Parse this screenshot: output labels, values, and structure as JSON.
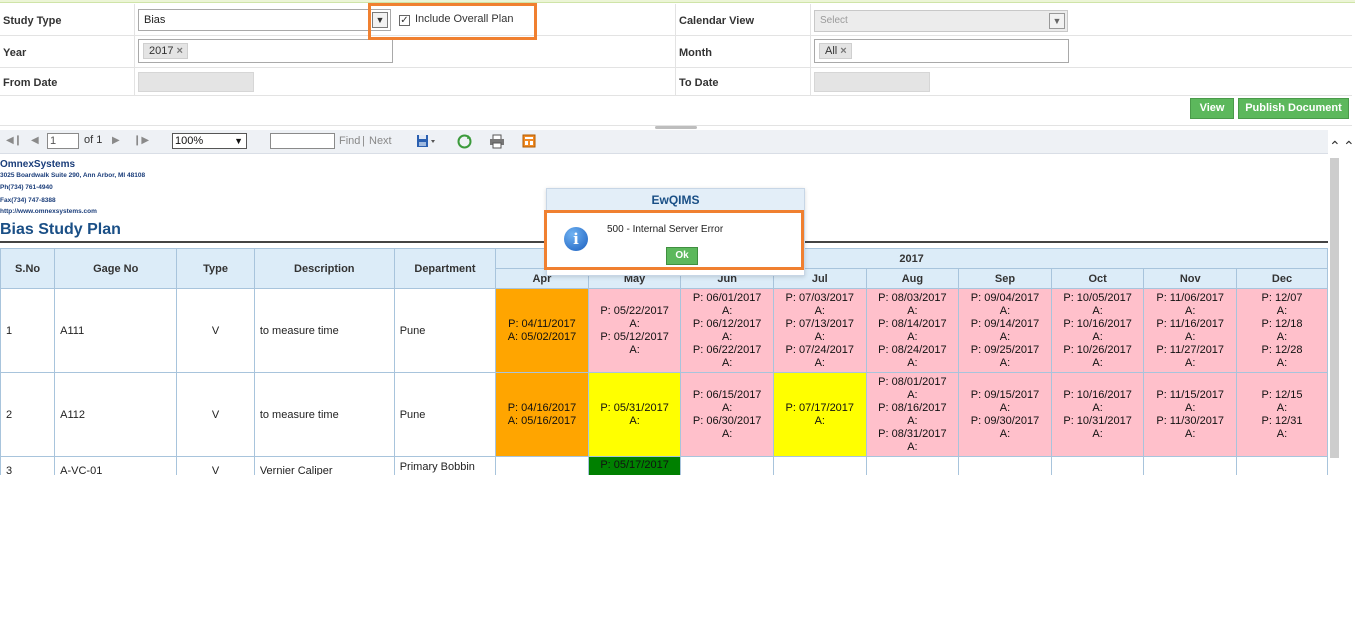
{
  "filters": {
    "study_type_label": "Study Type",
    "study_type_value": "Bias",
    "include_overall_label": "Include Overall Plan",
    "include_overall_checked": true,
    "calendar_view_label": "Calendar View",
    "calendar_view_placeholder": "Select",
    "year_label": "Year",
    "year_tag": "2017",
    "month_label": "Month",
    "month_tag": "All",
    "from_date_label": "From Date",
    "to_date_label": "To Date",
    "view_button": "View",
    "publish_button": "Publish Document"
  },
  "toolbar": {
    "page_value": "1",
    "page_of": "of 1",
    "zoom": "100%",
    "find": "Find",
    "separator": "|",
    "next": "Next",
    "icons": [
      "first-page-icon",
      "prev-page-icon",
      "next-page-icon",
      "last-page-icon",
      "export-icon",
      "refresh-icon",
      "print-icon",
      "document-map-icon"
    ]
  },
  "report": {
    "company": "OmnexSystems",
    "address": "3025 Boardwalk Suite 290, Ann Arbor, MI 48108",
    "phone": "Ph(734) 761-4940",
    "fax": "Fax(734) 747-8388",
    "web": "http://www.omnexsystems.com",
    "title": "Bias Study Plan",
    "headers": {
      "sno": "S.No",
      "gage": "Gage No",
      "type": "Type",
      "description": "Description",
      "department": "Department",
      "year": "2017"
    },
    "months": [
      "Apr",
      "May",
      "Jun",
      "Jul",
      "Aug",
      "Sep",
      "Oct",
      "Nov",
      "Dec"
    ],
    "rows": [
      {
        "sno": "1",
        "gage": "A111",
        "type": "V",
        "description": "to measure time",
        "department": "Pune",
        "cells": [
          {
            "color": "orange",
            "lines": [
              "P: 04/11/2017",
              "A: 05/02/2017"
            ]
          },
          {
            "color": "pink",
            "lines": [
              "P: 05/22/2017",
              "A:",
              "P: 05/12/2017",
              "A:"
            ]
          },
          {
            "color": "pink",
            "lines": [
              "P: 06/01/2017",
              "A:",
              "P: 06/12/2017",
              "A:",
              "P: 06/22/2017",
              "A:"
            ]
          },
          {
            "color": "pink",
            "lines": [
              "P: 07/03/2017",
              "A:",
              "P: 07/13/2017",
              "A:",
              "P: 07/24/2017",
              "A:"
            ]
          },
          {
            "color": "pink",
            "lines": [
              "P: 08/03/2017",
              "A:",
              "P: 08/14/2017",
              "A:",
              "P: 08/24/2017",
              "A:"
            ]
          },
          {
            "color": "pink",
            "lines": [
              "P: 09/04/2017",
              "A:",
              "P: 09/14/2017",
              "A:",
              "P: 09/25/2017",
              "A:"
            ]
          },
          {
            "color": "pink",
            "lines": [
              "P: 10/05/2017",
              "A:",
              "P: 10/16/2017",
              "A:",
              "P: 10/26/2017",
              "A:"
            ]
          },
          {
            "color": "pink",
            "lines": [
              "P: 11/06/2017",
              "A:",
              "P: 11/16/2017",
              "A:",
              "P: 11/27/2017",
              "A:"
            ]
          },
          {
            "color": "pink",
            "lines": [
              "P: 12/07",
              "A:",
              "P: 12/18",
              "A:",
              "P: 12/28",
              "A:"
            ]
          }
        ]
      },
      {
        "sno": "2",
        "gage": "A112",
        "type": "V",
        "description": "to measure time",
        "department": "Pune",
        "cells": [
          {
            "color": "orange",
            "lines": [
              "P: 04/16/2017",
              "A: 05/16/2017"
            ]
          },
          {
            "color": "yellow",
            "lines": [
              "P: 05/31/2017",
              "A:"
            ]
          },
          {
            "color": "pink",
            "lines": [
              "P: 06/15/2017",
              "A:",
              "P: 06/30/2017",
              "A:"
            ]
          },
          {
            "color": "yellow",
            "lines": [
              "P: 07/17/2017",
              "A:"
            ]
          },
          {
            "color": "pink",
            "lines": [
              "P: 08/01/2017",
              "A:",
              "P: 08/16/2017",
              "A:",
              "P: 08/31/2017",
              "A:"
            ]
          },
          {
            "color": "pink",
            "lines": [
              "P: 09/15/2017",
              "A:",
              "P: 09/30/2017",
              "A:"
            ]
          },
          {
            "color": "pink",
            "lines": [
              "P: 10/16/2017",
              "A:",
              "P: 10/31/2017",
              "A:"
            ]
          },
          {
            "color": "pink",
            "lines": [
              "P: 11/15/2017",
              "A:",
              "P: 11/30/2017",
              "A:"
            ]
          },
          {
            "color": "pink",
            "lines": [
              "P: 12/15",
              "A:",
              "P: 12/31",
              "A:"
            ]
          }
        ]
      },
      {
        "sno": "3",
        "gage": "A-VC-01",
        "type": "V",
        "description": "Vernier  Caliper",
        "department": "Primary Bobbin",
        "cells": [
          {
            "color": "white",
            "lines": []
          },
          {
            "color": "green",
            "lines": [
              "P: 05/17/2017"
            ]
          },
          {
            "color": "white",
            "lines": []
          },
          {
            "color": "white",
            "lines": []
          },
          {
            "color": "white",
            "lines": []
          },
          {
            "color": "white",
            "lines": []
          },
          {
            "color": "white",
            "lines": []
          },
          {
            "color": "white",
            "lines": []
          },
          {
            "color": "white",
            "lines": []
          }
        ]
      }
    ]
  },
  "dialog": {
    "title": "EwQIMS",
    "message": "500 - Internal Server Error",
    "ok": "Ok"
  },
  "colors": {
    "orange": "#ffa500",
    "pink": "#ffc0cb",
    "yellow": "#ffff00",
    "green": "#008000",
    "white": "#ffffff",
    "highlight": "#f08030",
    "button_green": "#5cb85c"
  }
}
